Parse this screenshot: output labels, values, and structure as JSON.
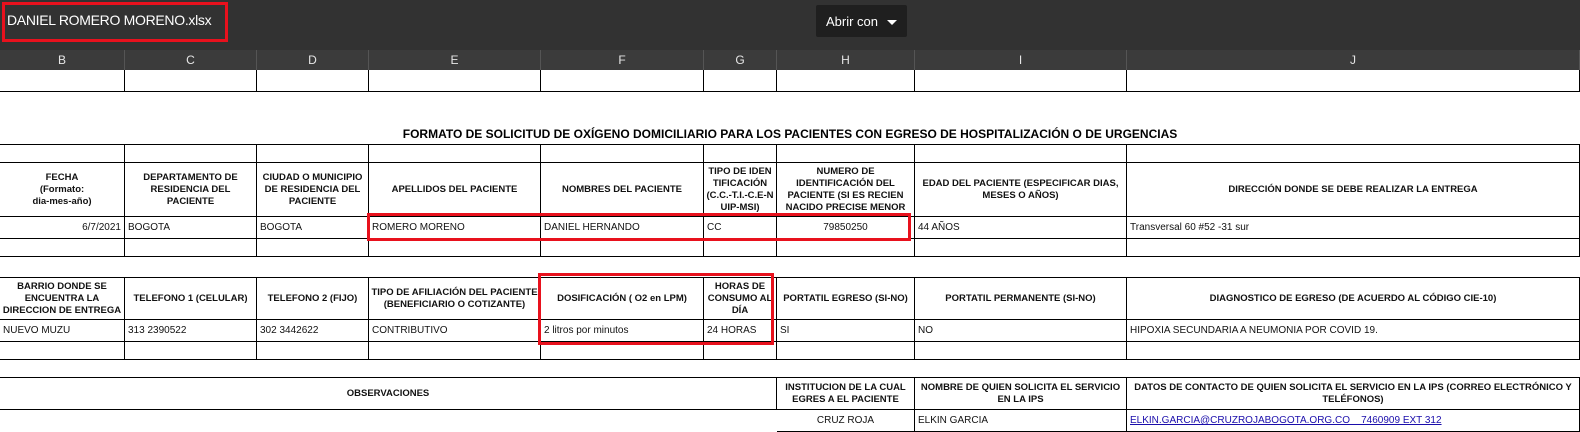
{
  "window": {
    "file_name": "DANIEL ROMERO MORENO.xlsx",
    "open_with_label": "Abrir con"
  },
  "columns": [
    "B",
    "C",
    "D",
    "E",
    "F",
    "G",
    "H",
    "I",
    "J"
  ],
  "sheet": {
    "title": "FORMATO DE SOLICITUD DE OXÍGENO DOMICILIARIO PARA LOS PACIENTES CON EGRESO DE HOSPITALIZACIÓN O DE URGENCIAS",
    "headers1": [
      "FECHA\n(Formato:\ndia-mes-año)",
      "DEPARTAMENTO DE RESIDENCIA DEL PACIENTE",
      "CIUDAD O MUNICIPIO DE RESIDENCIA DEL PACIENTE",
      "APELLIDOS DEL PACIENTE",
      "NOMBRES DEL PACIENTE",
      "TIPO DE IDENTIFICACIÓN (C.C.-T.I.-C.E-NUIP-MSI)",
      "NUMERO DE IDENTIFICACIÓN DEL PACIENTE (SI ES RECIEN NACIDO PRECISE MENOR SIN IDENTIFICACION)",
      "EDAD DEL PACIENTE (ESPECIFICAR DIAS, MESES O AÑOS)",
      "DIRECCIÓN DONDE SE DEBE REALIZAR LA ENTREGA"
    ],
    "values1": [
      "6/7/2021",
      "BOGOTA",
      "BOGOTA",
      "ROMERO MORENO",
      "DANIEL HERNANDO",
      "CC",
      "79850250",
      "44 AÑOS",
      "Transversal 60 #52 -31 sur"
    ],
    "headers2": [
      "BARRIO DONDE SE ENCUENTRA LA DIRECCION DE ENTREGA",
      "TELEFONO 1 (CELULAR)",
      "TELEFONO 2  (FIJO)",
      "TIPO DE AFILIACIÓN DEL PACIENTE (BENEFICIARIO O COTIZANTE)",
      "DOSIFICACIÓN ( O2 en LPM)",
      "HORAS DE CONSUMO AL DÍA",
      "PORTATIL EGRESO (SI-NO)",
      "PORTATIL PERMANENTE (SI-NO)",
      "DIAGNOSTICO DE EGRESO (DE ACUERDO AL CÓDIGO CIE-10)"
    ],
    "values2": [
      "NUEVO MUZU",
      "313 2390522",
      "302 3442622",
      "CONTRIBUTIVO",
      "2 litros por minutos",
      "24 HORAS",
      "SI",
      "NO",
      "HIPOXIA SECUNDARIA A NEUMONIA POR COVID 19."
    ],
    "headers3": {
      "observaciones": "OBSERVACIONES",
      "institucion": "INSTITUCION DE LA CUAL EGRES A EL PACIENTE",
      "solicitante": "NOMBRE DE QUIEN SOLICITA EL SERVICIO EN LA IPS",
      "contacto": "DATOS DE CONTACTO DE QUIEN SOLICITA EL SERVICIO EN LA IPS (CORREO ELECTRÓNICO Y TELÉFONOS)"
    },
    "values3": {
      "institucion": "CRUZ ROJA",
      "solicitante": "ELKIN GARCIA",
      "contacto": "ELKIN.GARCIA@CRUZROJABOGOTA.ORG.CO    7460909 EXT 312"
    }
  }
}
